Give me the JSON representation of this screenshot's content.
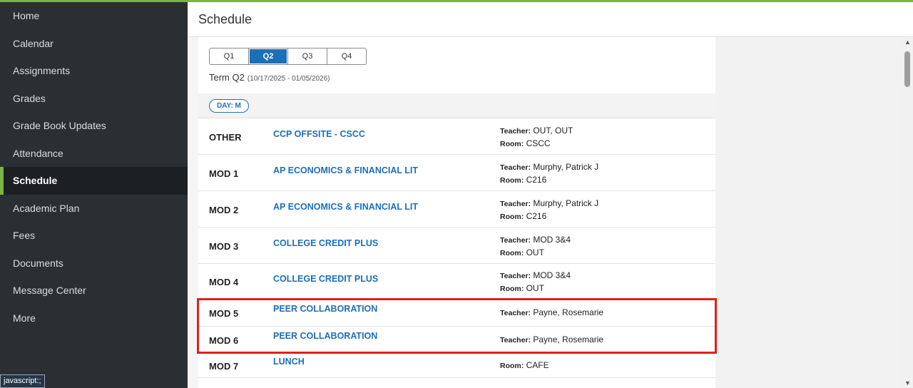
{
  "nav": {
    "items": [
      "Home",
      "Calendar",
      "Assignments",
      "Grades",
      "Grade Book Updates",
      "Attendance",
      "Schedule",
      "Academic Plan",
      "Fees",
      "Documents",
      "Message Center",
      "More"
    ],
    "active": "Schedule"
  },
  "status_tip": "javascript:;",
  "header": {
    "title": "Schedule"
  },
  "terms": {
    "tabs": [
      "Q1",
      "Q2",
      "Q3",
      "Q4"
    ],
    "selected": "Q2",
    "term_label": "Term Q2",
    "term_range": "(10/17/2025 - 01/05/2026)"
  },
  "day_filter": "DAY: M",
  "labels": {
    "teacher": "Teacher:",
    "room": "Room:"
  },
  "schedule": [
    {
      "period": "OTHER",
      "course": "CCP OFFSITE - CSCC",
      "teacher": "OUT, OUT",
      "room": "CSCC"
    },
    {
      "period": "MOD 1",
      "course": "AP ECONOMICS & FINANCIAL LIT",
      "teacher": "Murphy, Patrick J",
      "room": "C216"
    },
    {
      "period": "MOD 2",
      "course": "AP ECONOMICS & FINANCIAL LIT",
      "teacher": "Murphy, Patrick J",
      "room": "C216"
    },
    {
      "period": "MOD 3",
      "course": "COLLEGE CREDIT PLUS",
      "teacher": "MOD 3&4",
      "room": "OUT"
    },
    {
      "period": "MOD 4",
      "course": "COLLEGE CREDIT PLUS",
      "teacher": "MOD 3&4",
      "room": "OUT"
    },
    {
      "period": "MOD 5",
      "course": "PEER COLLABORATION",
      "teacher": "Payne, Rosemarie",
      "room": ""
    },
    {
      "period": "MOD 6",
      "course": "PEER COLLABORATION",
      "teacher": "Payne, Rosemarie",
      "room": ""
    },
    {
      "period": "MOD 7",
      "course": "LUNCH",
      "teacher": "",
      "room": "CAFE"
    }
  ],
  "colors": {
    "accent": "#7cb342",
    "link": "#1d6fb8",
    "sidebar": "#2a2f33",
    "highlight": "#e02020"
  }
}
